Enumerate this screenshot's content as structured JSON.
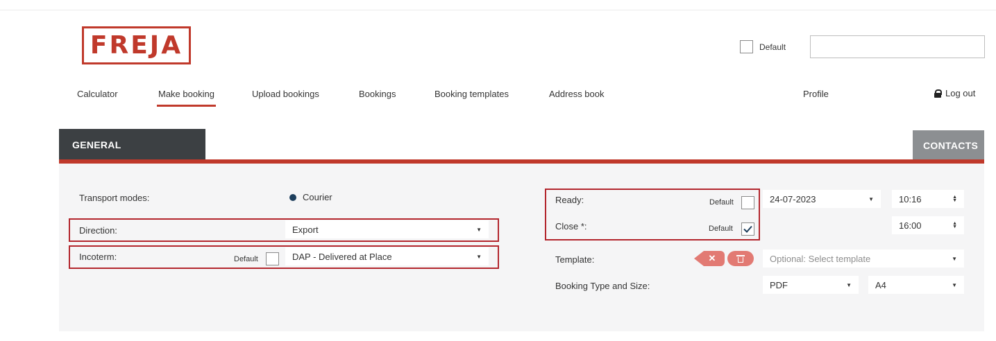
{
  "logo": {
    "text": "FREJA"
  },
  "header": {
    "default_label": "Default",
    "select_value": ""
  },
  "nav": {
    "items": [
      {
        "label": "Calculator"
      },
      {
        "label": "Make booking"
      },
      {
        "label": "Upload bookings"
      },
      {
        "label": "Bookings"
      },
      {
        "label": "Booking templates"
      },
      {
        "label": "Address book"
      }
    ],
    "profile": "Profile",
    "logout": "Log out"
  },
  "tabs": {
    "general": "GENERAL",
    "contacts": "CONTACTS"
  },
  "form": {
    "transport_modes_label": "Transport modes:",
    "transport_mode_value": "Courier",
    "direction_label": "Direction:",
    "direction_value": "Export",
    "incoterm_label": "Incoterm:",
    "incoterm_default_label": "Default",
    "incoterm_value": "DAP - Delivered at Place",
    "ready_label": "Ready:",
    "ready_default_label": "Default",
    "ready_date": "24-07-2023",
    "ready_time": "10:16",
    "close_label": "Close *:",
    "close_default_label": "Default",
    "close_time": "16:00",
    "template_label": "Template:",
    "template_placeholder": "Optional: Select template",
    "booking_type_label": "Booking Type and Size:",
    "booking_type_value": "PDF",
    "booking_size_value": "A4"
  },
  "colors": {
    "accent": "#c0392b",
    "tab_dark": "#3c4043",
    "tab_grey": "#8c8f92",
    "highlight": "#b3262d"
  }
}
